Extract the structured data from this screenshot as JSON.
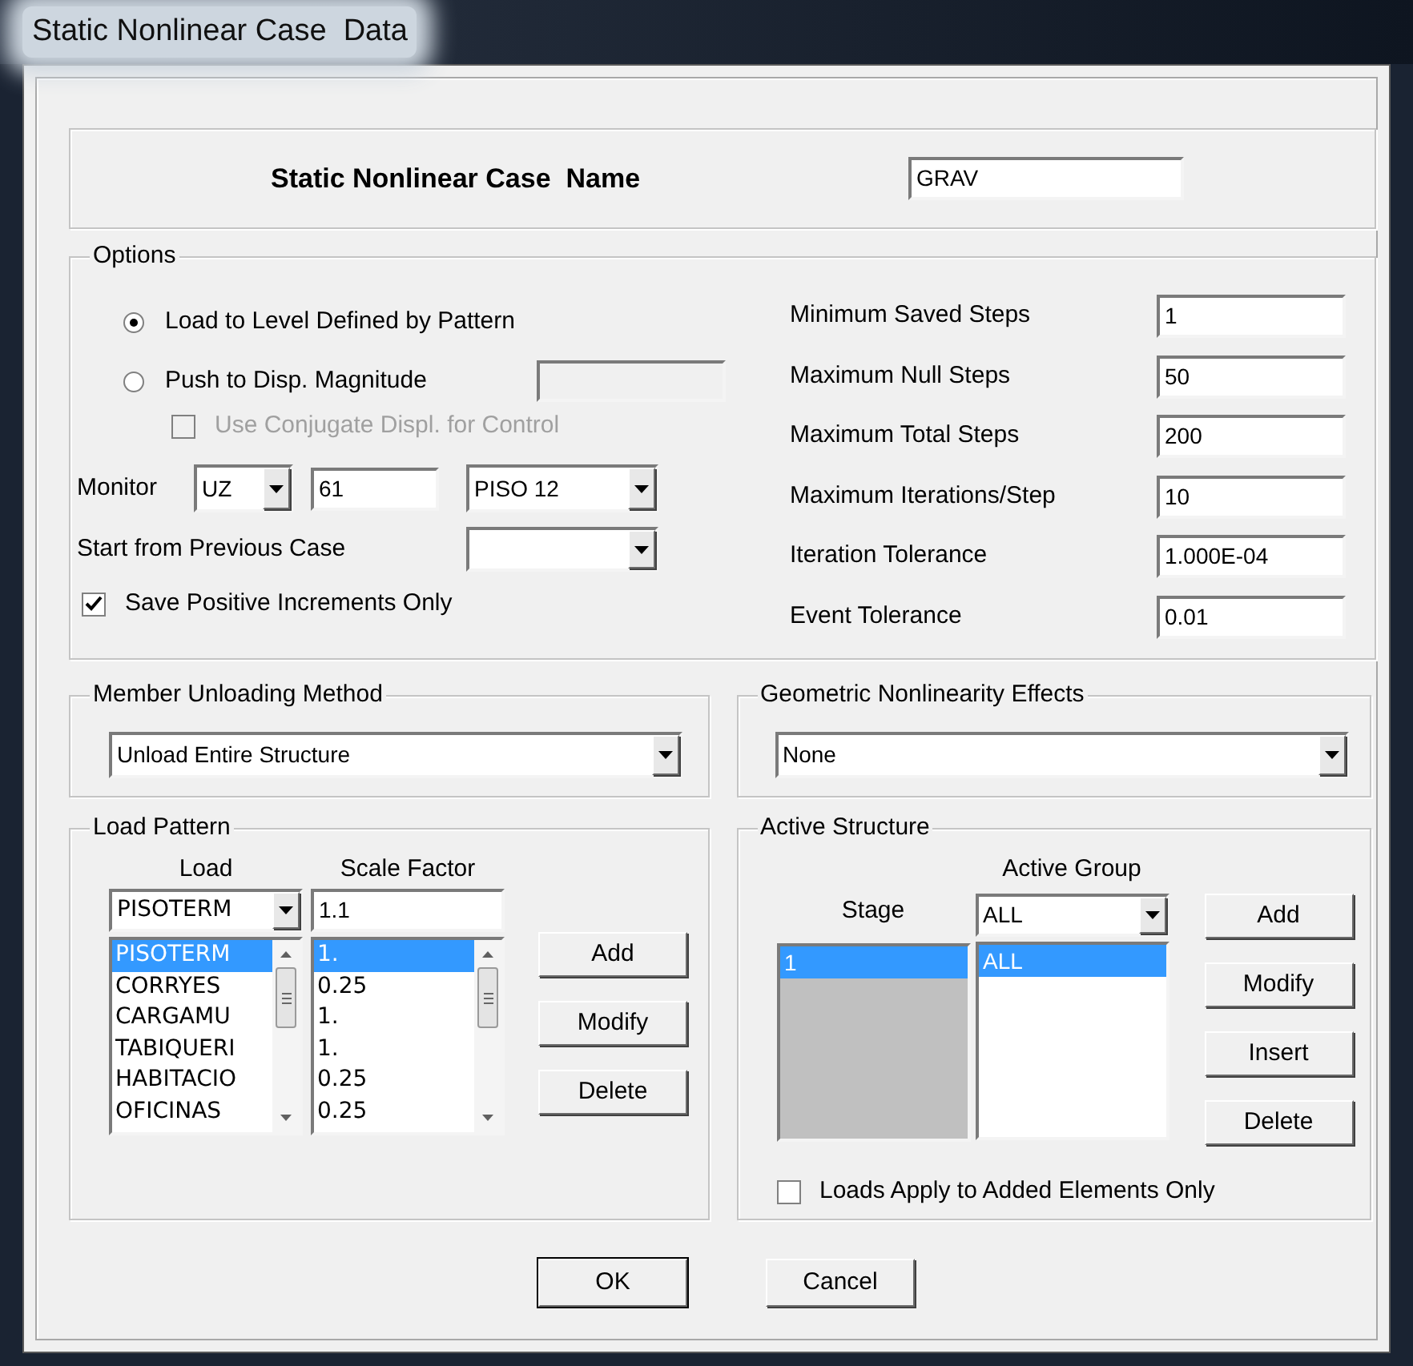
{
  "window": {
    "title": "Static Nonlinear Case  Data"
  },
  "case_name": {
    "label": "Static Nonlinear Case  Name",
    "value": "GRAV"
  },
  "options": {
    "title": "Options",
    "load_type": [
      {
        "label": "Load to Level Defined by Pattern",
        "selected": true
      },
      {
        "label": "Push to Disp. Magnitude",
        "selected": false
      }
    ],
    "disp_magnitude": {
      "disabled": true
    },
    "conjugate_displ": {
      "label": "Use Conjugate Displ. for Control",
      "checked": false,
      "disabled": true
    },
    "monitor": {
      "label": "Monitor",
      "dof": "UZ",
      "point": "61",
      "story": "PISO 12"
    },
    "start_from_previous": {
      "label": "Start from Previous Case"
    },
    "save_positive": {
      "label": "Save Positive Increments Only",
      "checked": true
    },
    "parameters": [
      {
        "label": "Minimum Saved Steps",
        "value": "1"
      },
      {
        "label": "Maximum Null Steps",
        "value": "50"
      },
      {
        "label": "Maximum Total Steps",
        "value": "200"
      },
      {
        "label": "Maximum Iterations/Step",
        "value": "10"
      },
      {
        "label": "Iteration Tolerance",
        "value": "1.000E-04"
      },
      {
        "label": "Event Tolerance",
        "value": "0.01"
      }
    ]
  },
  "member_unloading": {
    "title": "Member Unloading Method",
    "value": "Unload Entire Structure"
  },
  "geometric_nonlinearity": {
    "title": "Geometric Nonlinearity Effects",
    "value": "None"
  },
  "load_pattern": {
    "title": "Load Pattern",
    "load_header": "Load",
    "scale_header": "Scale Factor",
    "load": "PISOTERM",
    "scale_factor": "1.1",
    "rows": [
      {
        "load": "PISOTERM",
        "scale_factor": "1.",
        "selected": true
      },
      {
        "load": "CORRYES",
        "scale_factor": "0.25",
        "selected": false
      },
      {
        "load": "CARGAMU",
        "scale_factor": "1.",
        "selected": false
      },
      {
        "load": "TABIQUERI",
        "scale_factor": "1.",
        "selected": false
      },
      {
        "load": "HABITACIO",
        "scale_factor": "0.25",
        "selected": false
      },
      {
        "load": "OFICINAS",
        "scale_factor": "0.25",
        "selected": false
      }
    ],
    "buttons": [
      "Add",
      "Modify",
      "Delete"
    ]
  },
  "active_structure": {
    "title": "Active Structure",
    "stage_header": "Stage",
    "group_header": "Active Group",
    "group": "ALL",
    "rows": [
      {
        "stage": "1",
        "group": "ALL",
        "selected": true
      }
    ],
    "buttons": [
      "Add",
      "Modify",
      "Insert",
      "Delete"
    ],
    "loads_apply": {
      "label": "Loads Apply to Added Elements Only",
      "checked": false
    }
  },
  "buttons": [
    "OK",
    "Cancel"
  ]
}
